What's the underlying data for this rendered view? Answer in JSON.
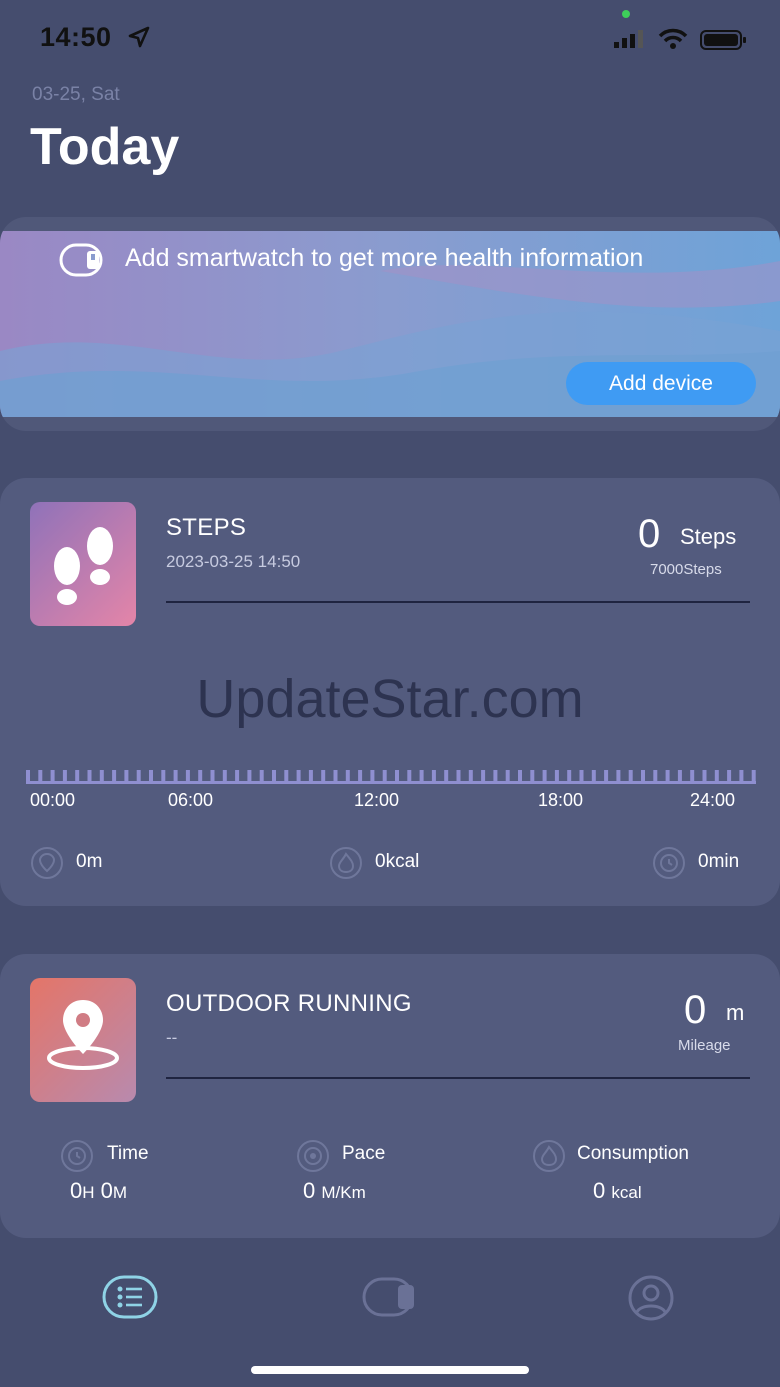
{
  "status_bar": {
    "time": "14:50"
  },
  "header": {
    "date": "03-25, Sat",
    "title": "Today"
  },
  "banner": {
    "message": "Add smartwatch to get more health information",
    "button_label": "Add device"
  },
  "steps_card": {
    "title": "STEPS",
    "datetime": "2023-03-25 14:50",
    "value": "0",
    "unit": "Steps",
    "goal": "7000Steps",
    "timeline": [
      "00:00",
      "06:00",
      "12:00",
      "18:00",
      "24:00"
    ],
    "distance": "0m",
    "calories": "0kcal",
    "duration": "0min"
  },
  "watermark": "UpdateStar.com",
  "running_card": {
    "title": "OUTDOOR RUNNING",
    "subtitle": "--",
    "value": "0",
    "unit": "m",
    "caption": "Mileage",
    "time_label": "Time",
    "time_h": "0",
    "time_h_unit": "H",
    "time_m": "0",
    "time_m_unit": "M",
    "pace_label": "Pace",
    "pace_value": "0",
    "pace_unit": "M/Km",
    "consumption_label": "Consumption",
    "consumption_value": "0",
    "consumption_unit": "kcal"
  },
  "tab_bar": {
    "items": [
      {
        "icon": "list-icon",
        "active": true
      },
      {
        "icon": "watch-icon",
        "active": false
      },
      {
        "icon": "profile-icon",
        "active": false
      }
    ]
  },
  "colors": {
    "background": "#454d6e",
    "card": "#535b7e",
    "accent_blue": "#3f9bf3",
    "active_tab": "#8fd3e6"
  }
}
